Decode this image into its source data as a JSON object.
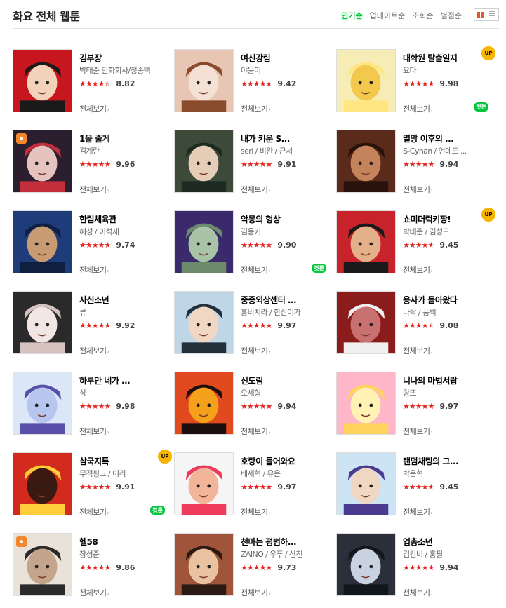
{
  "page_title": "화요 전체 웹툰",
  "sort_tabs": [
    "인기순",
    "업데이트순",
    "조회순",
    "별점순"
  ],
  "active_sort": 0,
  "more_label": "전체보기",
  "badges": {
    "up": "UP",
    "cut": "컷툰"
  },
  "colors": {
    "accent": "#00c73c",
    "star": "#e8251f",
    "up_badge": "#f7b500"
  },
  "webtoons": [
    {
      "title": "김부장",
      "author": "박태준 만화회사/정종택",
      "rating": "8.82",
      "badge": "",
      "person": false,
      "cut": false,
      "thumb": "thumb-kim-bujang"
    },
    {
      "title": "여신강림",
      "author": "야옹이",
      "rating": "9.42",
      "badge": "",
      "person": false,
      "cut": false,
      "thumb": "thumb-yeosin"
    },
    {
      "title": "대학원 탈출일지",
      "author": "요다",
      "rating": "9.98",
      "badge": "UP",
      "person": false,
      "cut": true,
      "thumb": "thumb-grad-school"
    },
    {
      "title": "1을 줄게",
      "author": "김계란",
      "rating": "9.96",
      "badge": "",
      "person": true,
      "cut": false,
      "thumb": "thumb-one"
    },
    {
      "title": "내가 키운 S...",
      "author": "seri / 비완 / 근서",
      "rating": "9.91",
      "badge": "",
      "person": false,
      "cut": false,
      "thumb": "thumb-s-rank"
    },
    {
      "title": "멸망 이후의 ...",
      "author": "S-Cynan / 언데드 ...",
      "rating": "9.94",
      "badge": "",
      "person": false,
      "cut": false,
      "thumb": "thumb-after-ruin"
    },
    {
      "title": "한림체육관",
      "author": "혜성 / 이석재",
      "rating": "9.74",
      "badge": "",
      "person": false,
      "cut": false,
      "thumb": "thumb-hallym-gym"
    },
    {
      "title": "악몽의 형상",
      "author": "김용키",
      "rating": "9.90",
      "badge": "",
      "person": false,
      "cut": true,
      "thumb": "thumb-nightmare"
    },
    {
      "title": "쇼미더럭키짱!",
      "author": "박태준 / 김성모",
      "rating": "9.45",
      "badge": "UP",
      "person": false,
      "cut": false,
      "thumb": "thumb-show-me"
    },
    {
      "title": "사신소년",
      "author": "류",
      "rating": "9.92",
      "badge": "",
      "person": false,
      "cut": false,
      "thumb": "thumb-reaper-boy"
    },
    {
      "title": "중증외상센터 ...",
      "author": "홍비치라 / 한산이가",
      "rating": "9.97",
      "badge": "",
      "person": false,
      "cut": false,
      "thumb": "thumb-trauma-center"
    },
    {
      "title": "용사가 돌아왔다",
      "author": "나락 / 풍백",
      "rating": "9.08",
      "badge": "",
      "person": false,
      "cut": false,
      "thumb": "thumb-hero-returns"
    },
    {
      "title": "하루만 네가 ...",
      "author": "삼",
      "rating": "9.98",
      "badge": "",
      "person": false,
      "cut": false,
      "thumb": "thumb-one-day"
    },
    {
      "title": "신도림",
      "author": "오세형",
      "rating": "9.94",
      "badge": "",
      "person": false,
      "cut": false,
      "thumb": "thumb-sindorim"
    },
    {
      "title": "니나의 마법서랍",
      "author": "랑또",
      "rating": "9.97",
      "badge": "",
      "person": false,
      "cut": false,
      "thumb": "thumb-nina"
    },
    {
      "title": "삼국지톡",
      "author": "무적핑크 / 이리",
      "rating": "9.91",
      "badge": "UP",
      "person": false,
      "cut": true,
      "thumb": "thumb-three-kingdoms"
    },
    {
      "title": "호랑이 들어와요",
      "author": "배세혁 / 유은",
      "rating": "9.97",
      "badge": "",
      "person": false,
      "cut": false,
      "thumb": "thumb-tiger"
    },
    {
      "title": "랜덤채팅의 그...",
      "author": "박은혁",
      "rating": "9.45",
      "badge": "",
      "person": false,
      "cut": false,
      "thumb": "thumb-random-chat"
    },
    {
      "title": "헬58",
      "author": "장성준",
      "rating": "9.86",
      "badge": "",
      "person": true,
      "cut": false,
      "thumb": "thumb-hell58"
    },
    {
      "title": "천마는 평범하...",
      "author": "ZAINO / 우푸 / 산천",
      "rating": "9.73",
      "badge": "",
      "person": false,
      "cut": false,
      "thumb": "thumb-heavenly-demon"
    },
    {
      "title": "엽총소년",
      "author": "김칸비 / 홍필",
      "rating": "9.94",
      "badge": "",
      "person": false,
      "cut": false,
      "thumb": "thumb-shotgun-boy"
    }
  ]
}
